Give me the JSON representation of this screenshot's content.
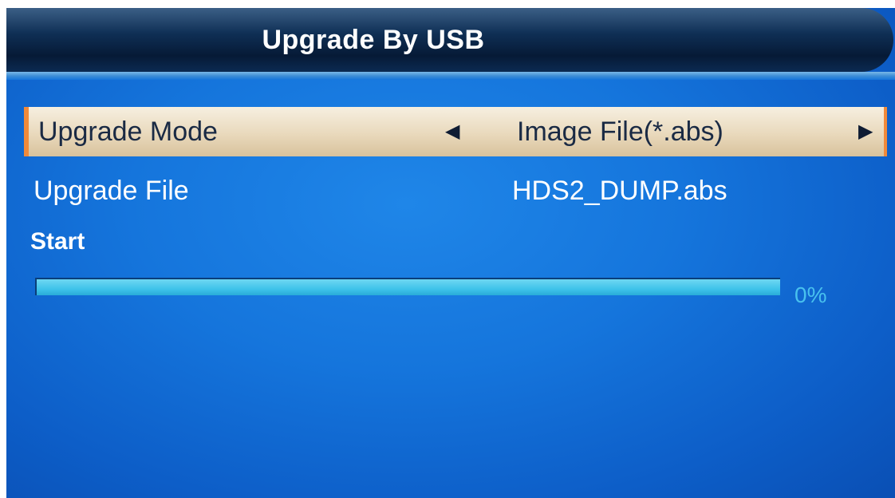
{
  "dialog": {
    "title": "Upgrade By USB"
  },
  "options": [
    {
      "label": "Upgrade Mode",
      "value": "Image File(*.abs)",
      "left_arrow": "◀",
      "right_arrow": "▶",
      "selected": true
    },
    {
      "label": "Upgrade File",
      "value": "HDS2_DUMP.abs"
    }
  ],
  "start": {
    "label": "Start"
  },
  "progress": {
    "percent_text": "0%",
    "value": 0
  },
  "colors": {
    "panel_blue": "#1575dc",
    "header_dark": "#0f2f55",
    "highlight_border": "#f18a3a",
    "progress_cyan": "#3fc3ea"
  }
}
